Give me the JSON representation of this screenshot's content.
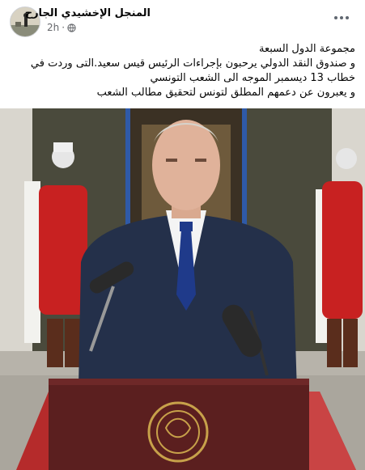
{
  "post": {
    "author_name": "المنجل الإخشيدي الجارح",
    "time": "2h",
    "separator": "·",
    "privacy_icon": "globe-icon",
    "more_icon": "more-options-icon",
    "lines": [
      "مجموعة الدول السبعة",
      "و صندوق النقد الدولي يرحبون بإجراءات الرئيس قيس سعيد.التى وردت في",
      "خطاب 13 ديسمبر الموجه الى  الشعب التونسي",
      "و يعبرون عن دعمهم المطلق لتونس لتحقيق مطالب الشعب"
    ]
  },
  "photo": {
    "description_icon": "president-speech-photo"
  }
}
